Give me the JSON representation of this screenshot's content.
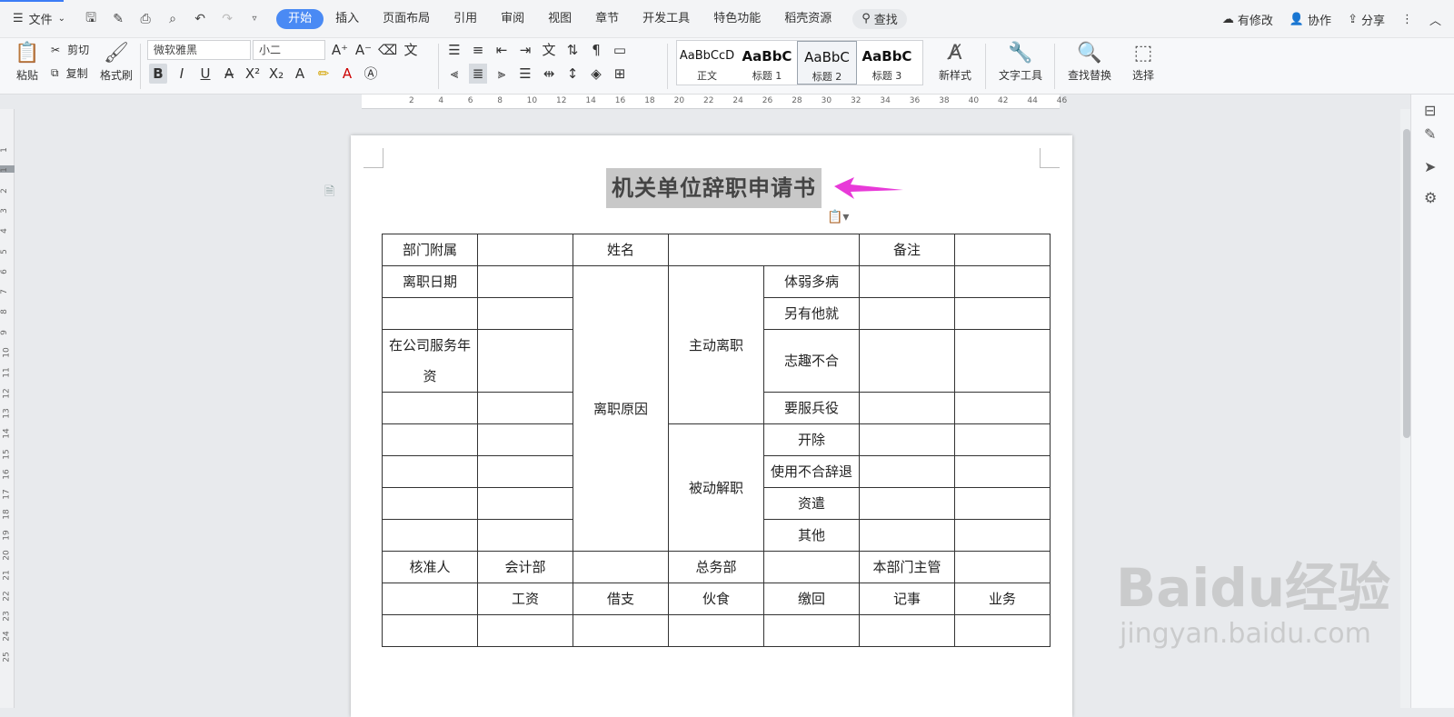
{
  "app": {
    "file_menu": "文件",
    "tabs": [
      "开始",
      "插入",
      "页面布局",
      "引用",
      "审阅",
      "视图",
      "章节",
      "开发工具",
      "特色功能",
      "稻壳资源"
    ],
    "active_tab": "开始",
    "search_label": "查找",
    "top_right": {
      "modified": "有修改",
      "collab": "协作",
      "share": "分享"
    }
  },
  "ribbon": {
    "paste": "粘贴",
    "cut": "剪切",
    "copy": "复制",
    "format_painter": "格式刷",
    "font_name": "微软雅黑",
    "font_size": "小二",
    "styles": [
      {
        "sample": "AaBbCcD",
        "label": "正文"
      },
      {
        "sample": "AaBbC",
        "label": "标题 1"
      },
      {
        "sample": "AaBbC",
        "label": "标题 2"
      },
      {
        "sample": "AaBbC",
        "label": "标题 3"
      }
    ],
    "new_style": "新样式",
    "text_tools": "文字工具",
    "find_replace": "查找替换",
    "select": "选择"
  },
  "ruler": {
    "h_marks": [
      "2",
      "4",
      "6",
      "8",
      "10",
      "12",
      "14",
      "16",
      "18",
      "20",
      "22",
      "24",
      "26",
      "28",
      "30",
      "32",
      "34",
      "36",
      "38",
      "40",
      "42",
      "44",
      "46"
    ],
    "v_marks": [
      "1",
      "1",
      "2",
      "3",
      "4",
      "5",
      "6",
      "7",
      "8",
      "9",
      "10",
      "11",
      "12",
      "13",
      "14",
      "15",
      "16",
      "17",
      "18",
      "19",
      "20",
      "21",
      "22",
      "23",
      "24",
      "25"
    ]
  },
  "document": {
    "title": "机关单位辞职申请书",
    "table": {
      "r1": {
        "c1": "部门附属",
        "c3": "姓名",
        "c5": "备注"
      },
      "r2": {
        "c1": "离职日期",
        "reason": "离职原因",
        "active": "主动离职",
        "passive": "被动解职"
      },
      "reasons": [
        "体弱多病",
        "另有他就",
        "志趣不合",
        "要服兵役",
        "开除",
        "使用不合辞退",
        "资遣",
        "其他"
      ],
      "service": "在公司服务年资",
      "approval_row": [
        "核准人",
        "会计部",
        "",
        "总务部",
        "",
        "本部门主管",
        ""
      ],
      "dept_row": [
        "",
        "工资",
        "借支",
        "伙食",
        "缴回",
        "记事",
        "业务"
      ]
    }
  },
  "watermark": {
    "logo": "Baidu经验",
    "url": "jingyan.baidu.com"
  },
  "colors": {
    "accent": "#4a8af4",
    "arrow": "#e83ad8"
  }
}
